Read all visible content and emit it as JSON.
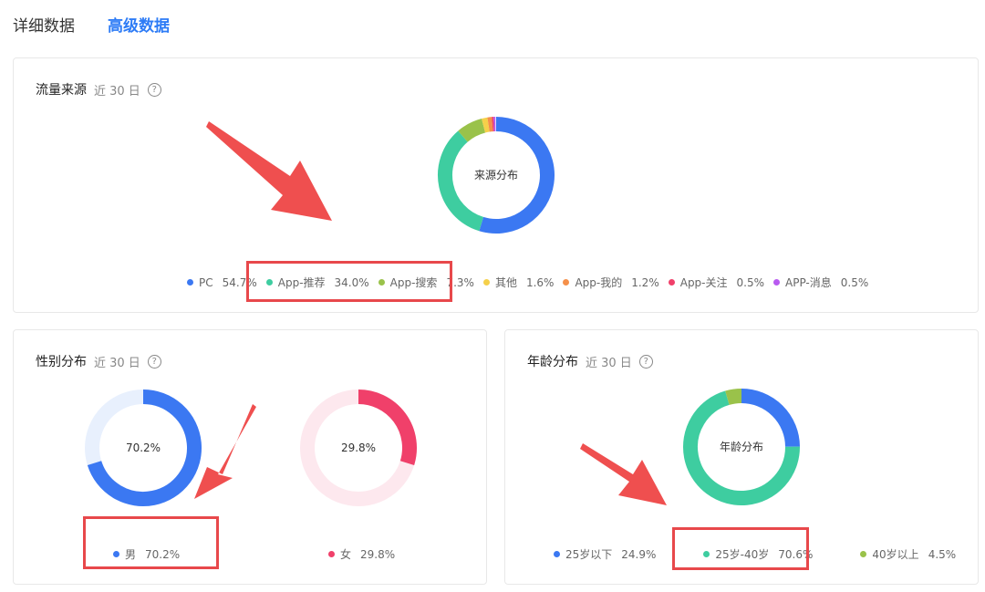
{
  "tabs": [
    {
      "label": "详细数据",
      "active": false
    },
    {
      "label": "高级数据",
      "active": true
    }
  ],
  "source_card": {
    "title": "流量来源",
    "range": "近 30 日",
    "help": "?"
  },
  "gender_card": {
    "title": "性别分布",
    "range": "近 30 日",
    "help": "?"
  },
  "age_card": {
    "title": "年龄分布",
    "range": "近 30 日",
    "help": "?"
  },
  "chart_data": [
    {
      "type": "pie",
      "id": "source",
      "center_label": "来源分布",
      "categories": [
        "PC",
        "App-推荐",
        "App-搜索",
        "其他",
        "App-我的",
        "App-关注",
        "APP-消息"
      ],
      "values": [
        54.7,
        34.0,
        7.3,
        1.6,
        1.2,
        0.5,
        0.5
      ],
      "labels": [
        "54.7%",
        "34.0%",
        "7.3%",
        "1.6%",
        "1.2%",
        "0.5%",
        "0.5%"
      ],
      "colors": [
        "#3b78f2",
        "#3ecda0",
        "#9ac24a",
        "#f5d04a",
        "#f5904a",
        "#f0406a",
        "#b85af0"
      ]
    },
    {
      "type": "pie",
      "id": "male",
      "center_label": "70.2%",
      "categories": [
        "男"
      ],
      "values": [
        70.2
      ],
      "labels": [
        "70.2%"
      ],
      "colors": [
        "#3b78f2"
      ],
      "track_color": "#e8f0fd"
    },
    {
      "type": "pie",
      "id": "female",
      "center_label": "29.8%",
      "categories": [
        "女"
      ],
      "values": [
        29.8
      ],
      "labels": [
        "29.8%"
      ],
      "colors": [
        "#f0406a"
      ],
      "track_color": "#fde8ee"
    },
    {
      "type": "pie",
      "id": "age",
      "center_label": "年龄分布",
      "categories": [
        "25岁以下",
        "25岁-40岁",
        "40岁以上"
      ],
      "values": [
        24.9,
        70.6,
        4.5
      ],
      "labels": [
        "24.9%",
        "70.6%",
        "4.5%"
      ],
      "colors": [
        "#3b78f2",
        "#3ecda0",
        "#9ac24a"
      ]
    }
  ],
  "highlight_color": "#e8484b"
}
